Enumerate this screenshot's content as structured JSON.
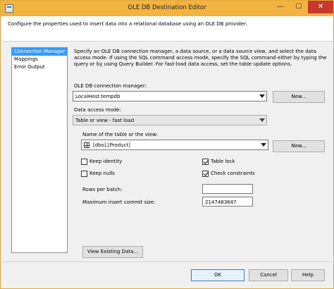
{
  "window": {
    "title": "OLE DB Destination Editor",
    "controls": {
      "minimize": "—",
      "maximize": "☐",
      "close": "✕"
    }
  },
  "header": {
    "text": "Configure the properties used to insert data into a relational database using an OLE DB provider."
  },
  "nav": {
    "items": [
      {
        "label": "Connection Manager",
        "selected": true
      },
      {
        "label": "Mappings",
        "selected": false
      },
      {
        "label": "Error Output",
        "selected": false
      }
    ]
  },
  "main": {
    "description": "Specify an OLE DB connection manager, a data source, or a data source view, and select the data access mode. If using the SQL command access mode, specify the SQL command either by typing the query or by using Query Builder. For fast-load data access, set the table update options.",
    "connection_manager_label": "OLE DB connection manager:",
    "connection_manager_value": "LocalHost.tempdb",
    "new_connection_button": "New...",
    "data_access_label": "Data access mode:",
    "data_access_value": "Table or view - fast load",
    "table_label": "Name of the table or the view:",
    "table_value": "[dbo].[Product]",
    "new_table_button": "New...",
    "options": {
      "keep_identity": {
        "label": "Keep identity",
        "checked": false
      },
      "keep_nulls": {
        "label": "Keep nulls",
        "checked": false
      },
      "table_lock": {
        "label": "Table lock",
        "checked": true
      },
      "check_constraints": {
        "label": "Check constraints",
        "checked": true
      }
    },
    "rows_per_batch_label": "Rows per batch:",
    "rows_per_batch_value": "",
    "max_commit_label": "Maximum insert commit size:",
    "max_commit_value": "2147483647",
    "view_data_button": "View Existing Data..."
  },
  "footer": {
    "ok": "OK",
    "cancel": "Cancel",
    "help": "Help"
  },
  "colors": {
    "titlebar": "#f2b341",
    "close": "#c7392d",
    "selection": "#3399ff"
  }
}
